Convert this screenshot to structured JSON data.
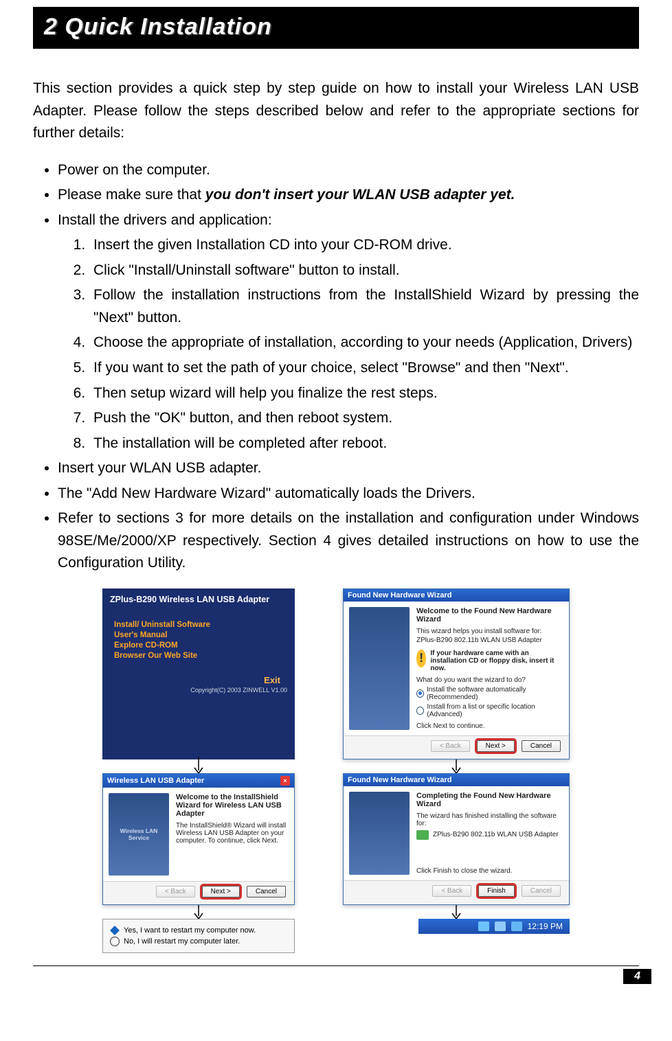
{
  "page_number": "4",
  "title": "2   Quick Installation",
  "intro": "This section provides a quick step by step guide on how to install your Wireless LAN USB Adapter. Please follow the steps described below and refer to the appropriate sections for further details:",
  "bullets": {
    "b1": "Power on the computer.",
    "b2_prefix": "Please make sure that ",
    "b2_emph": "you don't insert your WLAN USB adapter yet.",
    "b3": "Install the drivers and application:",
    "b4": "Insert your WLAN USB adapter.",
    "b5": "The \"Add New Hardware Wizard\" automatically loads the Drivers.",
    "b6": "Refer to sections 3 for more details on the installation and configuration under Windows 98SE/Me/2000/XP respectively. Section 4 gives detailed instructions on how to use the Configuration Utility."
  },
  "steps": {
    "s1": "Insert the given Installation CD into your CD-ROM drive.",
    "s2": "Click \"Install/Uninstall software\" button to install.",
    "s3": "Follow the installation instructions from the InstallShield Wizard by pressing the \"Next\" button.",
    "s4": "Choose the appropriate of installation, according to your needs (Application, Drivers)",
    "s5": "If you want to set the path of your choice, select \"Browse\" and then \"Next\".",
    "s6": "Then setup wizard will help you finalize the rest steps.",
    "s7": "Push the \"OK\" button, and then reboot system.",
    "s8": "The installation will be completed after reboot."
  },
  "cd_panel": {
    "title": "ZPlus-B290 Wireless LAN USB Adapter",
    "link1": "Install/ Uninstall Software",
    "link2": "User's Manual",
    "link3": "Explore CD-ROM",
    "link4": "Browser Our Web Site",
    "exit": "Exit",
    "copyright": "Copyright(C) 2003 ZINWELL V1.00"
  },
  "found_hw": {
    "titlebar": "Found New Hardware Wizard",
    "welcome_head": "Welcome to the Found New Hardware Wizard",
    "welcome_desc": "This wizard helps you install software for:",
    "device": "ZPlus-B290 802.11b WLAN USB Adapter",
    "cd_hint": "If your hardware came with an installation CD or floppy disk, insert it now.",
    "question": "What do you want the wizard to do?",
    "radio1": "Install the software automatically (Recommended)",
    "radio2": "Install from a list or specific location (Advanced)",
    "click_next": "Click Next to continue.",
    "back": "< Back",
    "next": "Next >",
    "cancel": "Cancel"
  },
  "install_shield": {
    "titlebar": "Wireless LAN USB Adapter",
    "side_label": "Wireless LAN Service",
    "head": "Welcome to the InstallShield Wizard for Wireless LAN USB Adapter",
    "desc": "The InstallShield® Wizard will install Wireless LAN USB Adapter on your computer. To continue, click Next.",
    "back": "< Back",
    "next": "Next >",
    "cancel": "Cancel"
  },
  "completing_hw": {
    "titlebar": "Found New Hardware Wizard",
    "head": "Completing the Found New Hardware Wizard",
    "desc": "The wizard has finished installing the software for:",
    "device": "ZPlus-B290 802.11b WLAN USB Adapter",
    "finish_hint": "Click Finish to close the wizard.",
    "back": "< Back",
    "finish": "Finish",
    "cancel": "Cancel"
  },
  "restart": {
    "yes": "Yes, I want to restart my computer now.",
    "no": "No, I will restart my computer later."
  },
  "tray_time": "12:19 PM"
}
